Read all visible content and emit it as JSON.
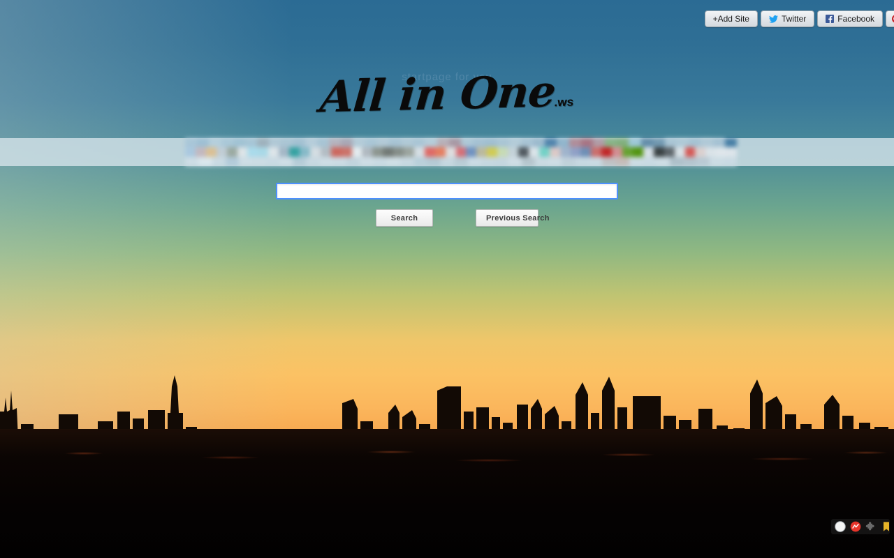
{
  "site": {
    "logo_text": "All in One",
    "logo_tld": ".ws",
    "logo_faint_text": "startpage for you"
  },
  "topbar": {
    "buttons": [
      {
        "label": "+Add Site",
        "icon": "plus-icon",
        "accent": "#333333"
      },
      {
        "label": "Twitter",
        "icon": "twitter-icon",
        "accent": "#1da1f2"
      },
      {
        "label": "Facebook",
        "icon": "facebook-icon",
        "accent": "#3b5998"
      },
      {
        "label": "",
        "icon": "pinterest-icon",
        "accent": "#cb2027"
      }
    ]
  },
  "favicon_band": {
    "description": "blurred bookmarks bar",
    "row1": [
      "#a8c6d8",
      "#9dbfd4",
      "#b5cfdd",
      "#a9c8d8",
      "#9fc2d4",
      "#a6c5d6",
      "#9db0bb",
      "#b0c8d6",
      "#aac5d4",
      "#a2c0d2",
      "#b6cddb",
      "#a7c4d4",
      "#b5b2bd",
      "#a8a6b4",
      "#b3cbd8",
      "#a9c6d6",
      "#b2cad7",
      "#a6c3d4",
      "#b0c9d7",
      "#a9c5d5",
      "#b5cdda",
      "#b8aeb6",
      "#a796a2",
      "#adc8d7",
      "#a4c1d3",
      "#9fbed1",
      "#a9c5d5",
      "#b3ccd9",
      "#a7c3d4",
      "#9ab9cd",
      "#4b80aa",
      "#8fb4cc",
      "#b08a96",
      "#a8707f",
      "#b09aa4",
      "#86b383",
      "#7fae79",
      "#9cc8d8",
      "#5f8aa7",
      "#6f97b0",
      "#a9c5d5",
      "#aec9d7",
      "#a5c2d3",
      "#b0c9d7",
      "#a4c1d3",
      "#417ba3"
    ],
    "row2": [
      "#a9c8e0",
      "#c4b7be",
      "#dcc091",
      "#c2cdd5",
      "#9aa89f",
      "#dfe5e8",
      "#aadcec",
      "#a9dae8",
      "#dfe6ea",
      "#a3b6c6",
      "#2fa0a0",
      "#84b9c8",
      "#d6dee3",
      "#b3bcc3",
      "#ce6258",
      "#cd6e64",
      "#e7eef1",
      "#b0b8bf",
      "#8b938c",
      "#6f7570",
      "#848b85",
      "#9ba39c",
      "#d8e0e5",
      "#e1645f",
      "#e87a5a",
      "#e0dfe0",
      "#d96b72",
      "#6d8fc0",
      "#bcb89a",
      "#d2cb4d",
      "#c8dcb4",
      "#c5d3d9",
      "#4c545a",
      "#dde5ea",
      "#6fd2c6",
      "#dfc9c6",
      "#9fb3cc",
      "#8d9ec6",
      "#6b8cb5",
      "#cc6a67",
      "#c21f1f",
      "#d58b90",
      "#62a028",
      "#4e9207",
      "#d9e2e8",
      "#343a3c",
      "#5a6166",
      "#dbe3e8",
      "#d8534f",
      "#ddd0cf",
      "#dce4e9",
      "#e1e8ec",
      "#dfe6eb"
    ],
    "row3": [
      "#cfdee6",
      "#dce8ee",
      "#cbdbe4",
      "#b3cbdb",
      "#cfdee6",
      "#cedde5",
      "#cbdbe4",
      "#d1dfe7",
      "#b6ccd8",
      "#c9d9e2",
      "#cfdee6",
      "#cddce5",
      "#c3d4de",
      "#d0dee6",
      "#cbdbe4",
      "#d2e0e7",
      "#c9d9e2",
      "#b9cfdb",
      "#b5c9d4",
      "#c8d8e1",
      "#b9ccd6",
      "#cddce5",
      "#c8d8e1",
      "#c6d6e0",
      "#d0dee6",
      "#b6c5cd",
      "#ccdbe3",
      "#cfdee6",
      "#c1d1db",
      "#c9d9e2",
      "#cbdbe4",
      "#c2c0c3",
      "#c7bbb8",
      "#cedde5",
      "#cbdbe4",
      "#d0dee6",
      "#aebfc9",
      "#b4c4ce",
      "#bacad4",
      "#cedde5",
      "#cbdbe4"
    ]
  },
  "search": {
    "value": "",
    "placeholder": "",
    "search_button": "Search",
    "previous_button": "Previous Search"
  },
  "tray": {
    "icons": [
      "compass-icon",
      "record-icon",
      "puzzle-extension-icon",
      "bookmark-icon"
    ]
  },
  "colors": {
    "sky_top": "#2b6b94",
    "sky_mid": "#8fb882",
    "sky_sun": "#fbc264",
    "ground": "#0b0503",
    "input_focus_border": "#4d90fe",
    "band_bg": "#d6e4ea"
  }
}
